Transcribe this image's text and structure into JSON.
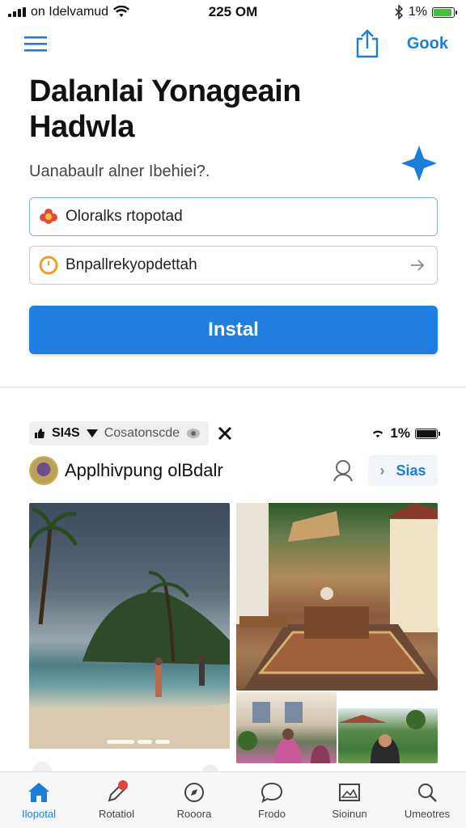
{
  "status_bar": {
    "carrier": "on Idelvamud",
    "time": "225 OM",
    "battery": "1%",
    "battery_level": 0.9
  },
  "top_nav": {
    "menu_icon": "hamburger-menu-icon",
    "share_icon": "share-icon",
    "action_label": "Gook"
  },
  "hero": {
    "title": "Dalanlai Yonageain Hadwla",
    "subtitle": "Uanabaulr alner Ibehiei?.",
    "decor_icon": "sparkle-icon",
    "accent": "#1b7fd8"
  },
  "form": {
    "field1_value": "Oloralks rtopotad",
    "field2_value": "Bnpallrekyopdettah",
    "install_label": "Instal",
    "button_color": "#1f7fe0"
  },
  "inner_status": {
    "left_label": "SI4S",
    "center_label": "Cosatonscde",
    "battery": "1%"
  },
  "profile": {
    "name": "Applhivpung olBdalr",
    "sign_label": "Sias"
  },
  "gallery": {
    "items": [
      "beach",
      "courtyard",
      "room",
      "garden"
    ]
  },
  "tab_bar": {
    "tabs": [
      {
        "label": "Ilopotal",
        "icon": "home-icon",
        "active": true
      },
      {
        "label": "Rotatiol",
        "icon": "pen-icon",
        "active": false
      },
      {
        "label": "Rooora",
        "icon": "compass-icon",
        "active": false
      },
      {
        "label": "Frodo",
        "icon": "chat-bubble-icon",
        "active": false
      },
      {
        "label": "Sioinun",
        "icon": "image-icon",
        "active": false
      },
      {
        "label": "Umeotres",
        "icon": "search-icon",
        "active": false
      }
    ]
  }
}
